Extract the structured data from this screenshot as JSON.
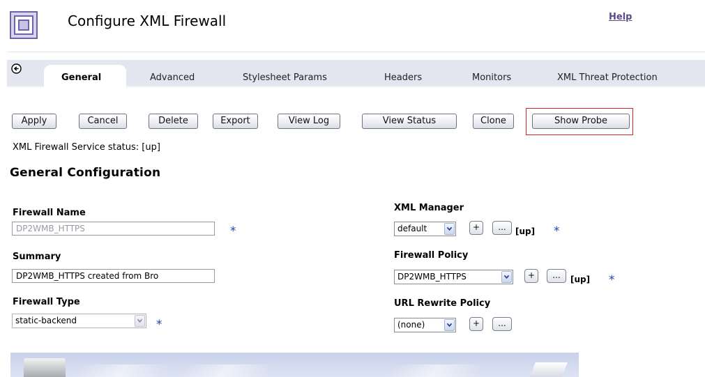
{
  "header": {
    "title": "Configure XML Firewall",
    "help_label": "Help",
    "logo_icon": "appliance-logo-icon"
  },
  "tabs": [
    {
      "label": "General",
      "active": true
    },
    {
      "label": "Advanced",
      "active": false
    },
    {
      "label": "Stylesheet Params",
      "active": false
    },
    {
      "label": "Headers",
      "active": false
    },
    {
      "label": "Monitors",
      "active": false
    },
    {
      "label": "XML Threat Protection",
      "active": false
    }
  ],
  "toolbar": {
    "apply": "Apply",
    "cancel": "Cancel",
    "delete": "Delete",
    "export": "Export",
    "view_log": "View Log",
    "view_status": "View Status",
    "clone": "Clone",
    "show_probe": "Show Probe"
  },
  "status_text": "XML Firewall Service status: [up]",
  "section_title": "General Configuration",
  "form": {
    "firewall_name": {
      "label": "Firewall Name",
      "value": "DP2WMB_HTTPS",
      "required_mark": "*"
    },
    "summary": {
      "label": "Summary",
      "value": "DP2WMB_HTTPS created from Bro"
    },
    "firewall_type": {
      "label": "Firewall Type",
      "value": "static-backend",
      "required_mark": "*"
    },
    "xml_manager": {
      "label": "XML Manager",
      "value": "default",
      "add_label": "+",
      "edit_label": "...",
      "status": "[up]",
      "required_mark": "*"
    },
    "firewall_policy": {
      "label": "Firewall Policy",
      "value": "DP2WMB_HTTPS",
      "add_label": "+",
      "edit_label": "...",
      "status": "[up]",
      "required_mark": "*"
    },
    "url_rewrite_policy": {
      "label": "URL Rewrite Policy",
      "value": "(none)",
      "add_label": "+",
      "edit_label": "..."
    }
  },
  "colors": {
    "tab_bar": "#e3e5ef",
    "required": "#2a3fb0",
    "highlight_frame": "#d02828",
    "help_link": "#5a4a87"
  }
}
